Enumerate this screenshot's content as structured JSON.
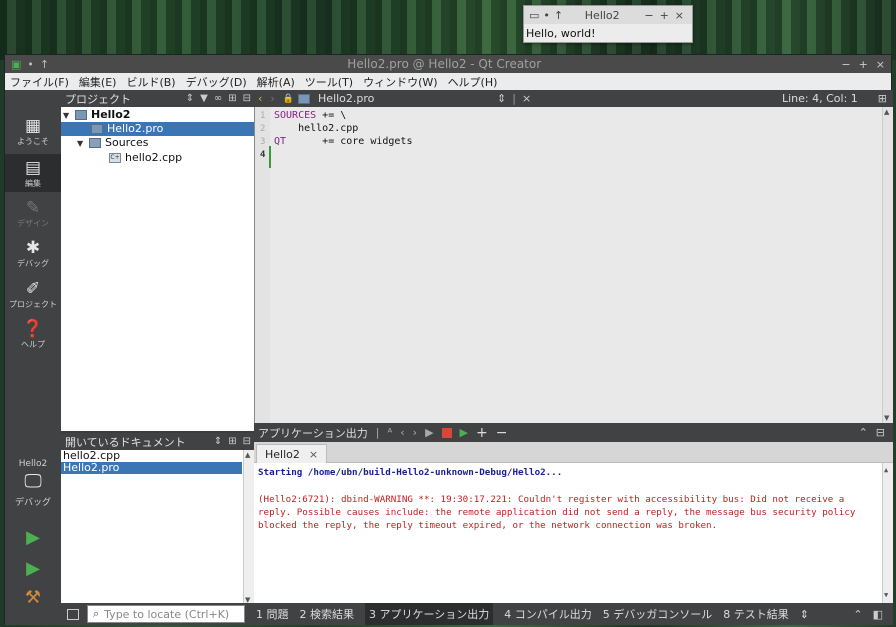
{
  "hello_window": {
    "title": "Hello2",
    "body": "Hello, world!"
  },
  "main": {
    "title": "Hello2.pro @ Hello2 - Qt Creator",
    "menu": [
      "ファイル(F)",
      "編集(E)",
      "ビルド(B)",
      "デバッグ(D)",
      "解析(A)",
      "ツール(T)",
      "ウィンドウ(W)",
      "ヘルプ(H)"
    ],
    "modes": [
      {
        "label": "ようこそ",
        "icon": "grid-icon"
      },
      {
        "label": "編集",
        "icon": "document-icon"
      },
      {
        "label": "デザイン",
        "icon": "pencil-icon"
      },
      {
        "label": "デバッグ",
        "icon": "bug-icon"
      },
      {
        "label": "プロジェクト",
        "icon": "wrench-icon"
      },
      {
        "label": "ヘルプ",
        "icon": "help-icon"
      }
    ],
    "kit": {
      "project": "Hello2",
      "config": "デバッグ"
    }
  },
  "project_panel": {
    "title": "プロジェクト",
    "root": "Hello2",
    "pro_file": "Hello2.pro",
    "sources_folder": "Sources",
    "source_file": "hello2.cpp"
  },
  "open_docs": {
    "title": "開いているドキュメント",
    "items": [
      "hello2.cpp",
      "Hello2.pro"
    ]
  },
  "editor": {
    "file": "Hello2.pro",
    "position": "Line: 4, Col: 1",
    "line_numbers": [
      "1",
      "2",
      "3",
      "4"
    ],
    "lines": [
      {
        "kw": "SOURCES",
        "rest": " += \\"
      },
      {
        "kw": "",
        "rest": "    hello2.cpp"
      },
      {
        "kw": "QT",
        "rest": "      += core widgets"
      }
    ]
  },
  "output": {
    "title": "アプリケーション出力",
    "tab": "Hello2",
    "start_line": "Starting /home/ubn/build-Hello2-unknown-Debug/Hello2...",
    "warning": "(Hello2:6721): dbind-WARNING **: 19:30:17.221: Couldn't register with accessibility bus: Did not receive a reply. Possible causes include: the remote application did not send a reply, the message bus security policy blocked the reply, the reply timeout expired, or the network connection was broken."
  },
  "status": {
    "locate_placeholder": "Type to locate (Ctrl+K)",
    "tabs": [
      "1 問題",
      "2 検索結果",
      "3 アプリケーション出力",
      "4 コンパイル出力",
      "5 デバッガコンソール",
      "8 テスト結果"
    ]
  }
}
